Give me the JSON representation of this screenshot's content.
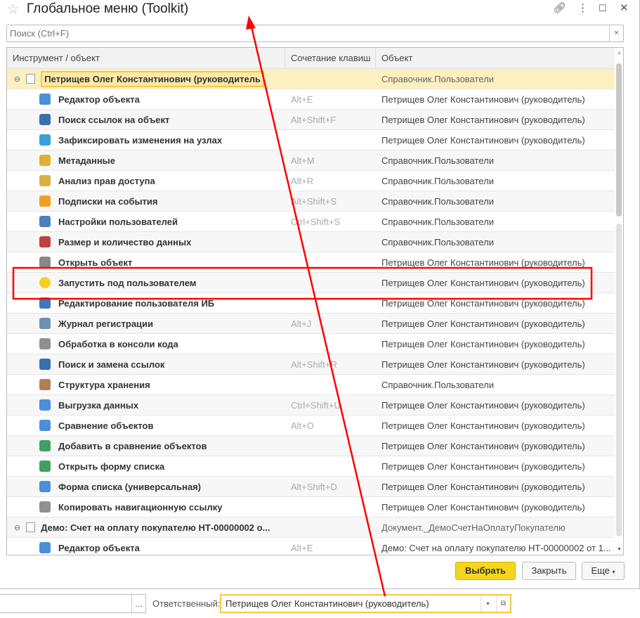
{
  "window": {
    "title": "Глобальное меню (Toolkit)"
  },
  "search": {
    "placeholder": "Поиск (Ctrl+F)",
    "clear": "×"
  },
  "columns": [
    "Инструмент / объект",
    "Сочетание клавиш",
    "Объект"
  ],
  "rows": [
    {
      "group": true,
      "selected": true,
      "name": "Петрищев Олег Константинович (руководитель",
      "key": "",
      "obj": "Справочник.Пользователи",
      "icon": "table-icon"
    },
    {
      "name": "Редактор объекта",
      "key": "Alt+E",
      "obj": "Петрищев Олег Константинович (руководитель)",
      "icon": "object-editor-icon",
      "color": "#4a8fd8"
    },
    {
      "name": "Поиск ссылок на объект",
      "key": "Alt+Shift+F",
      "obj": "Петрищев Олег Константинович (руководитель)",
      "icon": "search-refs-icon",
      "color": "#3b6fb0"
    },
    {
      "name": "Зафиксировать изменения на узлах",
      "key": "",
      "obj": "Петрищев Олег Константинович (руководитель)",
      "icon": "nodes-icon",
      "color": "#3aa0d8"
    },
    {
      "name": "Метаданные",
      "key": "Alt+M",
      "obj": "Справочник.Пользователи",
      "icon": "metadata-icon",
      "color": "#e0b030"
    },
    {
      "name": "Анализ прав доступа",
      "key": "Alt+R",
      "obj": "Справочник.Пользователи",
      "icon": "lock-icon",
      "color": "#d8b040"
    },
    {
      "name": "Подписки на события",
      "key": "Alt+Shift+S",
      "obj": "Справочник.Пользователи",
      "icon": "lightning-icon",
      "color": "#f0a020"
    },
    {
      "name": "Настройки пользователей",
      "key": "Ctrl+Shift+S",
      "obj": "Справочник.Пользователи",
      "icon": "user-settings-icon",
      "color": "#4a7fc0"
    },
    {
      "name": "Размер и количество данных",
      "key": "",
      "obj": "Справочник.Пользователи",
      "icon": "chart-icon",
      "color": "#c04040"
    },
    {
      "name": "Открыть объект",
      "key": "",
      "obj": "Петрищев Олег Константинович (руководитель)",
      "icon": "open-object-icon",
      "color": "#888888"
    },
    {
      "name": "Запустить под пользователем",
      "key": "",
      "obj": "Петрищев Олег Константинович (руководитель)",
      "icon": "1c-logo-icon",
      "color": "#f5d020"
    },
    {
      "name": "Редактирование пользователя ИБ",
      "key": "",
      "obj": "Петрищев Олег Константинович (руководитель)",
      "icon": "user-icon",
      "color": "#3a7ac0"
    },
    {
      "name": "Журнал регистрации",
      "key": "Alt+J",
      "obj": "Петрищев Олег Константинович (руководитель)",
      "icon": "log-icon",
      "color": "#7090b0"
    },
    {
      "name": "Обработка в консоли кода",
      "key": "",
      "obj": "Петрищев Олег Константинович (руководитель)",
      "icon": "console-icon",
      "color": "#909090"
    },
    {
      "name": "Поиск и замена ссылок",
      "key": "Alt+Shift+R",
      "obj": "Петрищев Олег Константинович (руководитель)",
      "icon": "replace-refs-icon",
      "color": "#3b6fb0"
    },
    {
      "name": "Структура хранения",
      "key": "",
      "obj": "Справочник.Пользователи",
      "icon": "storage-icon",
      "color": "#b08050"
    },
    {
      "name": "Выгрузка данных",
      "key": "Ctrl+Shift+U",
      "obj": "Петрищев Олег Константинович (руководитель)",
      "icon": "export-icon",
      "color": "#4a8fd8"
    },
    {
      "name": "Сравнение объектов",
      "key": "Alt+O",
      "obj": "Петрищев Олег Константинович (руководитель)",
      "icon": "compare-icon",
      "color": "#4a8fd8"
    },
    {
      "name": "Добавить в сравнение объектов",
      "key": "",
      "obj": "Петрищев Олег Константинович (руководитель)",
      "icon": "add-compare-icon",
      "color": "#40a060"
    },
    {
      "name": "Открыть форму списка",
      "key": "",
      "obj": "Петрищев Олег Константинович (руководитель)",
      "icon": "list-form-icon",
      "color": "#40a060"
    },
    {
      "name": "Форма списка (универсальная)",
      "key": "Alt+Shift+D",
      "obj": "Петрищев Олег Константинович (руководитель)",
      "icon": "universal-list-icon",
      "color": "#4a8fd8"
    },
    {
      "name": "Копировать навигационную ссылку",
      "key": "",
      "obj": "Петрищев Олег Константинович (руководитель)",
      "icon": "copy-link-icon",
      "color": "#909090"
    },
    {
      "group": true,
      "name": "Демо: Счет на оплату покупателю НТ-00000002 о...",
      "key": "",
      "obj": "Документ._ДемоСчетНаОплатуПокупателю",
      "icon": "document-icon"
    },
    {
      "name": "Редактор объекта",
      "key": "Alt+E",
      "obj": "Демо: Счет на оплату покупателю НТ-00000002 от 1...",
      "icon": "object-editor-icon",
      "color": "#4a8fd8"
    }
  ],
  "buttons": {
    "select": "Выбрать",
    "close": "Закрыть",
    "more": "Еще"
  },
  "bottom": {
    "ellipsis": "...",
    "label": "Ответственный:",
    "value": "Петрищев Олег Константинович (руководитель)"
  },
  "colors": {
    "accent": "#f5d020",
    "highlight": "#fdf0c0",
    "annotation": "#ff0000"
  }
}
